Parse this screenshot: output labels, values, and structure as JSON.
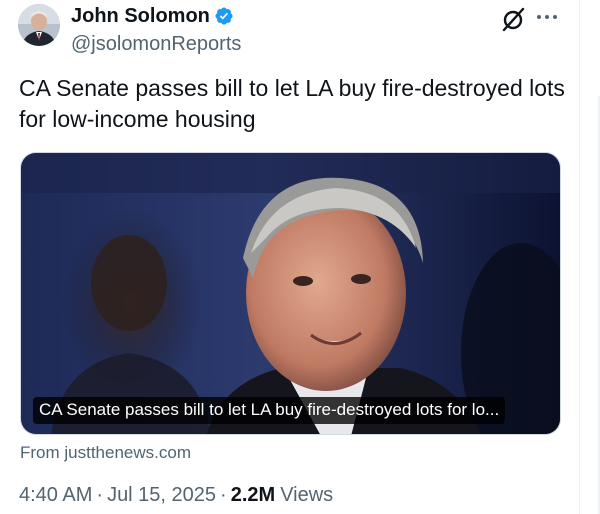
{
  "author": {
    "display_name": "John Solomon",
    "handle": "@jsolomonReports",
    "verified": true,
    "avatar": "author-avatar-photo"
  },
  "actions": {
    "grok_icon": "grok-slash-circle-icon",
    "more_icon": "more-dots-icon"
  },
  "tweet": {
    "text": "CA Senate passes bill to let LA buy fire-destroyed lots for low-income housing"
  },
  "media": {
    "caption": "CA Senate passes bill to let LA buy fire-destroyed lots for lo...",
    "source": "From justthenews.com"
  },
  "meta": {
    "time": "4:40 AM",
    "separator": "·",
    "date": "Jul 15, 2025",
    "views_count": "2.2M",
    "views_label": "Views"
  },
  "colors": {
    "text_primary": "#0f1419",
    "text_secondary": "#536471",
    "verified_blue": "#1d9bf0",
    "border": "#cfd9de"
  }
}
